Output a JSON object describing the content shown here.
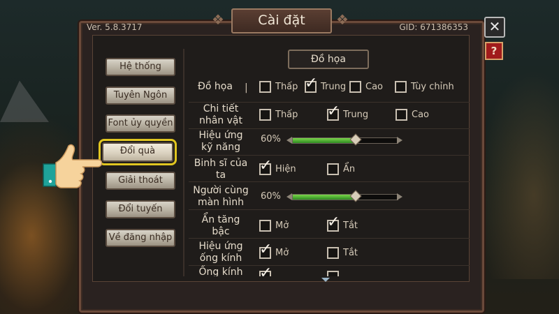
{
  "window": {
    "title": "Cài đặt",
    "version": "Ver. 5.8.3717",
    "gid": "GID: 671386353",
    "close_icon": "close-icon",
    "help_label": "?"
  },
  "sidebar": {
    "items": [
      {
        "label": "Hệ thống"
      },
      {
        "label": "Tuyên Ngôn"
      },
      {
        "label": "Font ủy quyền"
      },
      {
        "label": "Đổi quà",
        "active": true
      },
      {
        "label": "Giải thoát"
      },
      {
        "label": "Đổi tuyến"
      },
      {
        "label": "Về đăng nhập"
      }
    ]
  },
  "section": {
    "title": "Đồ họa"
  },
  "settings": {
    "graphics": {
      "label": "Đồ họa",
      "sep": "|",
      "options": [
        "Thấp",
        "Trung",
        "Cao",
        "Tùy chỉnh"
      ],
      "selected": "Trung"
    },
    "character_detail": {
      "label_line1": "Chi tiết",
      "label_line2": "nhân vật",
      "options": [
        "Thấp",
        "Trung",
        "Cao"
      ],
      "selected": "Trung"
    },
    "skill_effect": {
      "label_line1": "Hiệu ứng",
      "label_line2": "kỹ năng",
      "percent_text": "60%",
      "value": 0.6
    },
    "own_soldiers": {
      "label_line1": "Binh sĩ của",
      "label_line2": "ta",
      "options": [
        "Hiện",
        "Ẩn"
      ],
      "selected": "Hiện"
    },
    "same_screen": {
      "label_line1": "Người cùng",
      "label_line2": "màn hình",
      "percent_text": "60%",
      "value": 0.6
    },
    "hide_rank": {
      "label_line1": "Ẩn tăng",
      "label_line2": "bậc",
      "options": [
        "Mở",
        "Tắt"
      ],
      "selected": "Tắt"
    },
    "lens_effect": {
      "label_line1": "Hiệu ứng",
      "label_line2": "ống kính",
      "options": [
        "Mở",
        "Tắt"
      ],
      "selected": "Mở"
    },
    "lens_partial": {
      "label_line1": "Ống kính"
    }
  },
  "colors": {
    "highlight": "#e0c520",
    "slider_fill": "#3fa82c",
    "help_button": "#a11c1c"
  }
}
